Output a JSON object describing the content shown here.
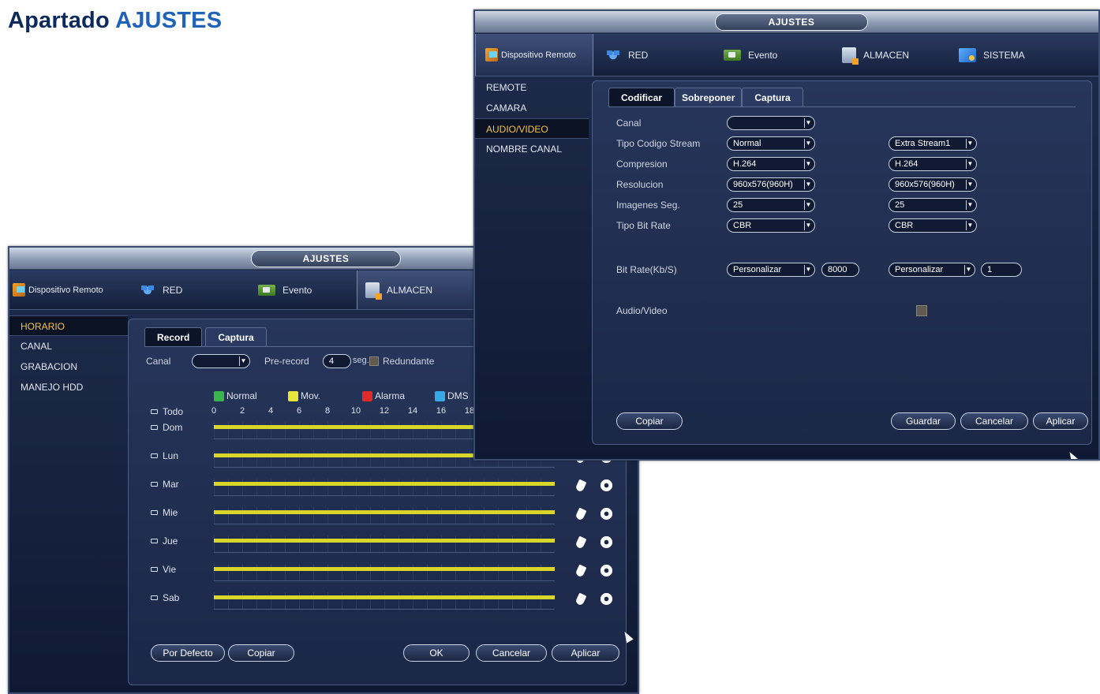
{
  "heading": {
    "prefix": "Apartado",
    "highlight": "AJUSTES"
  },
  "colors": {
    "heading_dark": "#0d2a5c",
    "heading_accent": "#1f63b8",
    "window_bg": "#1b2747",
    "active_item": "#f3c24b",
    "schedule_bar": "#d8d62a"
  },
  "back_window": {
    "title": "AJUSTES",
    "nav_tabs": [
      {
        "label": "Dispositivo Remoto",
        "icon": "device-icon"
      },
      {
        "label": "RED",
        "icon": "network-icon"
      },
      {
        "label": "Evento",
        "icon": "event-icon"
      },
      {
        "label": "ALMACEN",
        "icon": "storage-icon"
      }
    ],
    "sidebar": [
      "HORARIO",
      "CANAL",
      "GRABACION",
      "MANEJO HDD"
    ],
    "sub_tabs": [
      "Record",
      "Captura"
    ],
    "canal_label": "Canal",
    "canal_value": "",
    "prerecord_label": "Pre-record",
    "prerecord_value": "4",
    "prerecord_unit": "seg.",
    "redundante_label": "Redundante",
    "legend": [
      {
        "label": "Normal",
        "color": "#39b54a"
      },
      {
        "label": "Mov.",
        "color": "#e6e63a"
      },
      {
        "label": "Alarma",
        "color": "#e02a2a"
      },
      {
        "label": "DMS",
        "color": "#37a8e8"
      }
    ],
    "todo_label": "Todo",
    "hours": [
      "0",
      "2",
      "4",
      "6",
      "8",
      "10",
      "12",
      "14",
      "16",
      "18"
    ],
    "days": [
      "Dom",
      "Lun",
      "Mar",
      "Mie",
      "Jue",
      "Vie",
      "Sab"
    ],
    "buttons": {
      "default": "Por Defecto",
      "copy": "Copiar",
      "ok": "OK",
      "cancel": "Cancelar",
      "apply": "Aplicar"
    }
  },
  "front_window": {
    "title": "AJUSTES",
    "nav_tabs": [
      {
        "label": "Dispositivo Remoto",
        "icon": "device-icon"
      },
      {
        "label": "RED",
        "icon": "network-icon"
      },
      {
        "label": "Evento",
        "icon": "event-icon"
      },
      {
        "label": "ALMACEN",
        "icon": "storage-icon"
      },
      {
        "label": "SISTEMA",
        "icon": "system-icon"
      }
    ],
    "sidebar": [
      "REMOTE",
      "CAMARA",
      "AUDIO/VIDEO",
      "NOMBRE CANAL"
    ],
    "sub_tabs": [
      "Codificar",
      "Sobreponer",
      "Captura"
    ],
    "fields": {
      "canal": {
        "label": "Canal",
        "value": ""
      },
      "tipo_stream": {
        "label": "Tipo Codigo Stream",
        "main": "Normal",
        "extra": "Extra Stream1"
      },
      "compresion": {
        "label": "Compresion",
        "main": "H.264",
        "extra": "H.264"
      },
      "resolucion": {
        "label": "Resolucion",
        "main": "960x576(960H)",
        "extra": "960x576(960H)"
      },
      "imagenes": {
        "label": "Imagenes Seg.",
        "main": "25",
        "extra": "25"
      },
      "bitrate_type": {
        "label": "Tipo Bit Rate",
        "main": "CBR",
        "extra": "CBR"
      },
      "bitrate": {
        "label": "Bit Rate(Kb/S)",
        "main_mode": "Personalizar",
        "main_value": "8000",
        "extra_mode": "Personalizar",
        "extra_value": "1"
      },
      "audio_video": {
        "label": "Audio/Video"
      }
    },
    "buttons": {
      "copy": "Copiar",
      "save": "Guardar",
      "cancel": "Cancelar",
      "apply": "Aplicar"
    }
  }
}
